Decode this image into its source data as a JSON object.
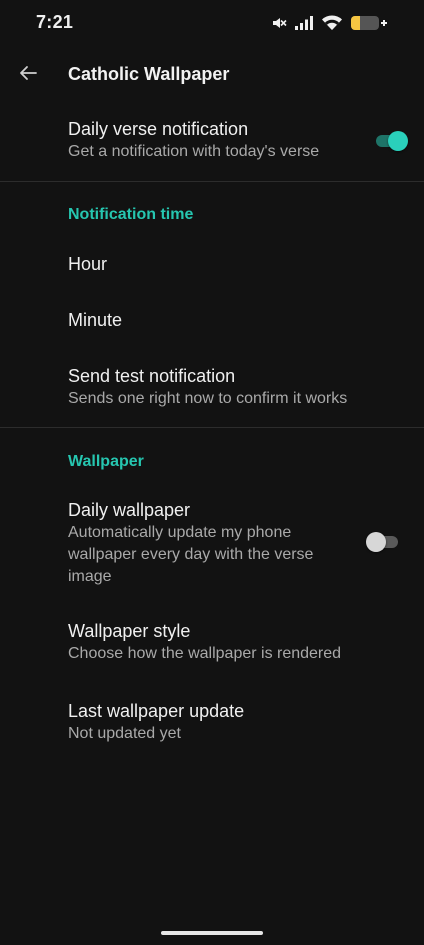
{
  "status_bar": {
    "time": "7:21",
    "icons": [
      "mute-icon",
      "signal-icon",
      "wifi-icon",
      "battery-icon"
    ],
    "battery_color": "#f5c542"
  },
  "app_bar": {
    "title": "Catholic Wallpaper"
  },
  "accent_color": "#26c6b0",
  "daily_verse": {
    "title": "Daily verse notification",
    "summary": "Get a notification with today's verse",
    "enabled": true
  },
  "notification_section": {
    "header": "Notification time",
    "hour_title": "Hour",
    "minute_title": "Minute",
    "test_title": "Send test notification",
    "test_summary": "Sends one right now to confirm it works"
  },
  "wallpaper_section": {
    "header": "Wallpaper",
    "daily_title": "Daily wallpaper",
    "daily_summary": "Automatically update my phone wallpaper every day with the verse image",
    "daily_enabled": false,
    "style_title": "Wallpaper style",
    "style_summary": "Choose how the wallpaper is rendered",
    "last_title": "Last wallpaper update",
    "last_summary": "Not updated yet"
  }
}
